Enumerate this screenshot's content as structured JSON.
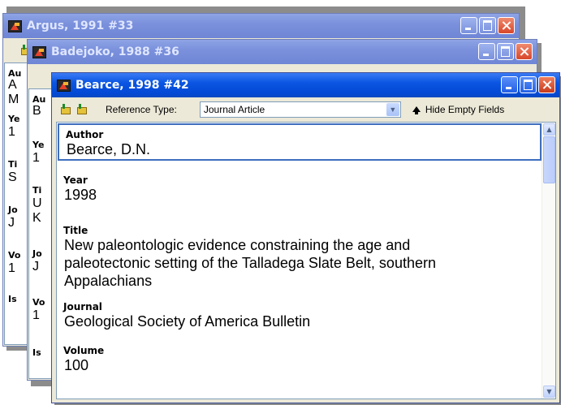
{
  "windows": {
    "back": {
      "title": "Argus, 1991 #33",
      "field_stubs": [
        "Au",
        "Ye",
        "Ti",
        "Jo",
        "Vo",
        "Is"
      ],
      "value_stubs": [
        "A",
        "M",
        "1",
        "S",
        "J",
        "1"
      ]
    },
    "middle": {
      "title": "Badejoko, 1988 #36",
      "field_stubs": [
        "Au",
        "Ye",
        "Ti",
        "Jo",
        "Vo",
        "Is"
      ],
      "value_stubs": [
        "B",
        "1",
        "U",
        "K",
        "J",
        "1"
      ]
    },
    "front": {
      "title": "Bearce, 1998 #42",
      "toolbar": {
        "reference_type_label": "Reference Type:",
        "reference_type_value": "Journal Article",
        "hide_empty_label": "Hide Empty Fields"
      },
      "fields": [
        {
          "label": "Author",
          "value": "Bearce, D.N."
        },
        {
          "label": "Year",
          "value": "1998"
        },
        {
          "label": "Title",
          "lines": [
            "New paleontologic evidence constraining the age and",
            "paleotectonic setting of the Talladega Slate Belt, southern",
            "Appalachians"
          ]
        },
        {
          "label": "Journal",
          "value": "Geological Society of America Bulletin"
        },
        {
          "label": "Volume",
          "value": "100"
        }
      ]
    }
  }
}
